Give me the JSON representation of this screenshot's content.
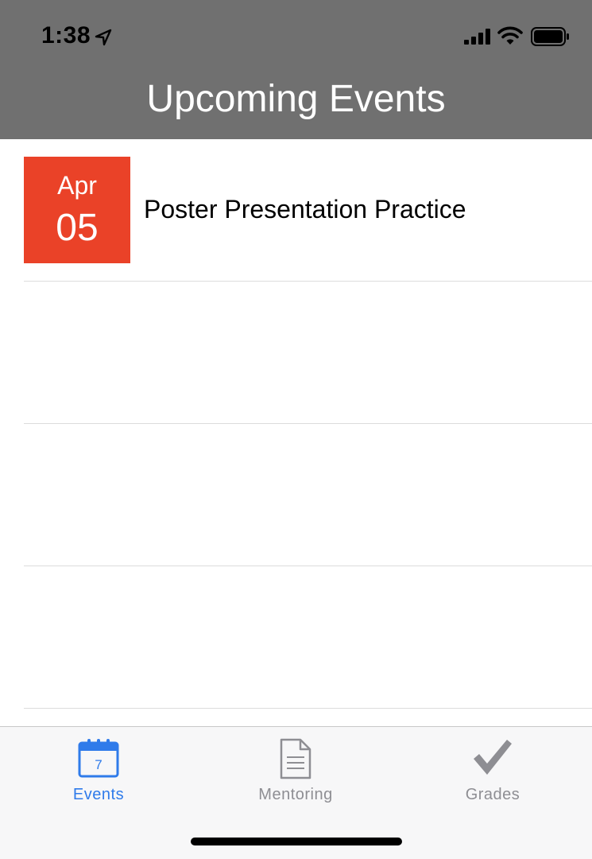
{
  "status_bar": {
    "time": "1:38",
    "icons": [
      "location-arrow-icon",
      "signal-icon",
      "wifi-icon",
      "battery-icon"
    ]
  },
  "header": {
    "title": "Upcoming Events",
    "background": "#707070"
  },
  "events": [
    {
      "month": "Apr",
      "day": "05",
      "title": "Poster Presentation Practice",
      "badge_color": "#ea4228"
    }
  ],
  "tabbar": {
    "tabs": [
      {
        "label": "Events",
        "icon": "calendar-icon",
        "icon_text": "7",
        "active": true
      },
      {
        "label": "Mentoring",
        "icon": "document-icon",
        "active": false
      },
      {
        "label": "Grades",
        "icon": "checkmark-icon",
        "active": false
      }
    ],
    "active_color": "#2f7bea",
    "inactive_color": "#8e8e93"
  }
}
